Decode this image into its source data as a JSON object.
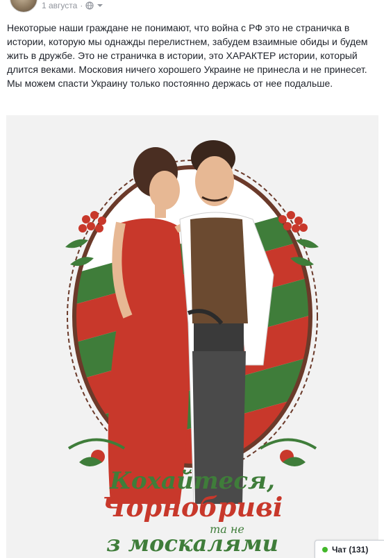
{
  "post": {
    "date": "1 августа",
    "separator": "·",
    "privacy_icon": "globe-icon",
    "menu_icon": "chevron-down-icon",
    "text": "Некоторые наши граждане не понимают, что война с РФ это не страничка в истории, которую мы однажды перелистнем, забудем взаимные обиды и будем жить в дружбе. Это не страничка в истории, это ХАРАКТЕР истории, который длится веками. Московия ничего хорошего Украине не принесла и не принесет. Мы можем спасти Украину только постоянно держась от нее подальше."
  },
  "artwork": {
    "line1": "Кохайтеся,",
    "line2": "Чорнобриві",
    "line3": "та не",
    "line4": "з москалями"
  },
  "chat": {
    "label": "Чат (131)",
    "status_color": "#42b72a"
  },
  "colors": {
    "accent_red": "#c8382b",
    "accent_green": "#3f7d3a",
    "link_gray": "#90949c"
  }
}
